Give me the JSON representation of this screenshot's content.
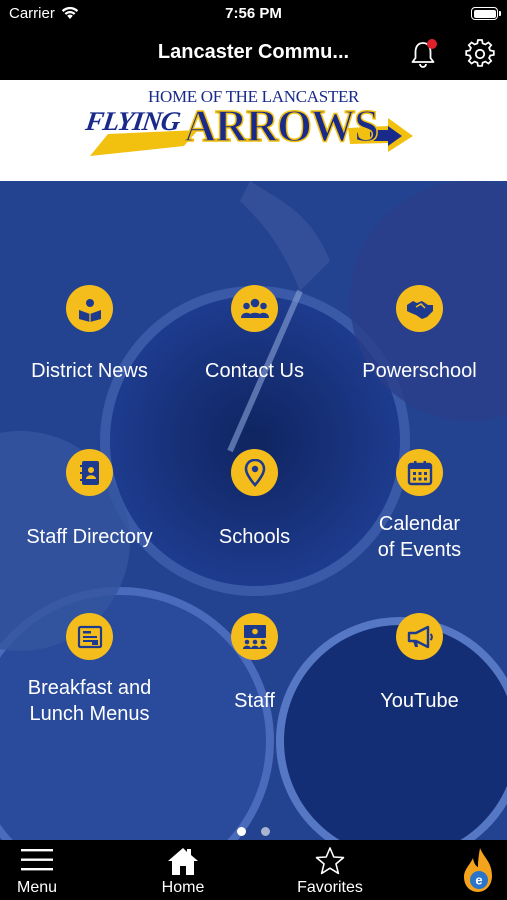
{
  "status": {
    "carrier": "Carrier",
    "time": "7:56 PM"
  },
  "nav": {
    "title": "Lancaster Commu...",
    "notification_color": "#e0202a"
  },
  "banner": {
    "line1": "HOME OF THE LANCASTER",
    "line2": "FLYING",
    "line3": "ARROWS"
  },
  "tiles": [
    {
      "label": "District News",
      "icon": "reading-book-icon"
    },
    {
      "label": "Contact Us",
      "icon": "people-group-icon"
    },
    {
      "label": "Powerschool",
      "icon": "handshake-icon"
    },
    {
      "label": "Staff Directory",
      "icon": "contact-book-icon"
    },
    {
      "label": "Schools",
      "icon": "map-pin-icon"
    },
    {
      "label_lines": [
        "Calendar",
        "of Events"
      ],
      "icon": "calendar-icon"
    },
    {
      "label_lines": [
        "Breakfast and",
        "Lunch Menus"
      ],
      "icon": "menu-document-icon"
    },
    {
      "label": "Staff",
      "icon": "presentation-board-icon"
    },
    {
      "label": "YouTube",
      "icon": "megaphone-icon"
    }
  ],
  "pager": {
    "pages": 2,
    "current": 1
  },
  "tab_bar": {
    "menu": "Menu",
    "home": "Home",
    "favorites": "Favorites"
  },
  "colors": {
    "accent": "#f5bd1c",
    "background_tint": "#1d3a8e",
    "brand_blue": "#1a2a8a"
  }
}
